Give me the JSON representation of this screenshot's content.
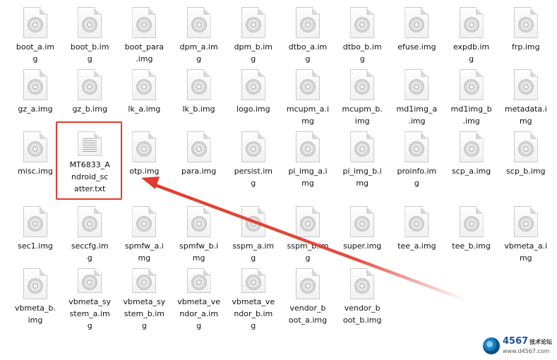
{
  "files": [
    {
      "name": "boot_a.img",
      "label_lines": [
        "boot_a.im",
        "g"
      ],
      "type": "img"
    },
    {
      "name": "boot_b.img",
      "label_lines": [
        "boot_b.im",
        "g"
      ],
      "type": "img"
    },
    {
      "name": "boot_para.img",
      "label_lines": [
        "boot_para",
        ".img"
      ],
      "type": "img"
    },
    {
      "name": "dpm_a.img",
      "label_lines": [
        "dpm_a.im",
        "g"
      ],
      "type": "img"
    },
    {
      "name": "dpm_b.img",
      "label_lines": [
        "dpm_b.im",
        "g"
      ],
      "type": "img"
    },
    {
      "name": "dtbo_a.img",
      "label_lines": [
        "dtbo_a.im",
        "g"
      ],
      "type": "img"
    },
    {
      "name": "dtbo_b.img",
      "label_lines": [
        "dtbo_b.im",
        "g"
      ],
      "type": "img"
    },
    {
      "name": "efuse.img",
      "label_lines": [
        "efuse.img"
      ],
      "type": "img"
    },
    {
      "name": "expdb.img",
      "label_lines": [
        "expdb.im",
        "g"
      ],
      "type": "img"
    },
    {
      "name": "frp.img",
      "label_lines": [
        "frp.img"
      ],
      "type": "img"
    },
    {
      "name": "gz_a.img",
      "label_lines": [
        "gz_a.img"
      ],
      "type": "img"
    },
    {
      "name": "gz_b.img",
      "label_lines": [
        "gz_b.img"
      ],
      "type": "img"
    },
    {
      "name": "lk_a.img",
      "label_lines": [
        "lk_a.img"
      ],
      "type": "img"
    },
    {
      "name": "lk_b.img",
      "label_lines": [
        "lk_b.img"
      ],
      "type": "img"
    },
    {
      "name": "logo.img",
      "label_lines": [
        "logo.img"
      ],
      "type": "img"
    },
    {
      "name": "mcupm_a.img",
      "label_lines": [
        "mcupm_a.i",
        "mg"
      ],
      "type": "img"
    },
    {
      "name": "mcupm_b.img",
      "label_lines": [
        "mcupm_b.",
        "img"
      ],
      "type": "img"
    },
    {
      "name": "md1img_a.img",
      "label_lines": [
        "md1img_a",
        ".img"
      ],
      "type": "img"
    },
    {
      "name": "md1img_b.img",
      "label_lines": [
        "md1img_b",
        ".img"
      ],
      "type": "img"
    },
    {
      "name": "metadata.img",
      "label_lines": [
        "metadata.i",
        "mg"
      ],
      "type": "img"
    },
    {
      "name": "misc.img",
      "label_lines": [
        "misc.img"
      ],
      "type": "img"
    },
    {
      "name": "MT6833_Android_scatter.txt",
      "label_lines": [
        "MT6833_A",
        "ndroid_sc",
        "atter.txt"
      ],
      "type": "txt"
    },
    {
      "name": "otp.img",
      "label_lines": [
        "otp.img"
      ],
      "type": "img"
    },
    {
      "name": "para.img",
      "label_lines": [
        "para.img"
      ],
      "type": "img"
    },
    {
      "name": "persist.img",
      "label_lines": [
        "persist.im",
        "g"
      ],
      "type": "img"
    },
    {
      "name": "pi_img_a.img",
      "label_lines": [
        "pi_img_a.i",
        "mg"
      ],
      "type": "img"
    },
    {
      "name": "pi_img_b.img",
      "label_lines": [
        "pi_img_b.i",
        "mg"
      ],
      "type": "img"
    },
    {
      "name": "proinfo.img",
      "label_lines": [
        "proinfo.im",
        "g"
      ],
      "type": "img"
    },
    {
      "name": "scp_a.img",
      "label_lines": [
        "scp_a.img"
      ],
      "type": "img"
    },
    {
      "name": "scp_b.img",
      "label_lines": [
        "scp_b.img"
      ],
      "type": "img"
    },
    {
      "name": "sec1.img",
      "label_lines": [
        "sec1.img"
      ],
      "type": "img"
    },
    {
      "name": "seccfg.img",
      "label_lines": [
        "seccfg.im",
        "g"
      ],
      "type": "img"
    },
    {
      "name": "spmfw_a.img",
      "label_lines": [
        "spmfw_a.i",
        "mg"
      ],
      "type": "img"
    },
    {
      "name": "spmfw_b.img",
      "label_lines": [
        "spmfw_b.i",
        "mg"
      ],
      "type": "img"
    },
    {
      "name": "sspm_a.img",
      "label_lines": [
        "sspm_a.im",
        "g"
      ],
      "type": "img"
    },
    {
      "name": "sspm_b.img",
      "label_lines": [
        "sspm_b.im",
        "g"
      ],
      "type": "img"
    },
    {
      "name": "super.img",
      "label_lines": [
        "super.img"
      ],
      "type": "img"
    },
    {
      "name": "tee_a.img",
      "label_lines": [
        "tee_a.img"
      ],
      "type": "img"
    },
    {
      "name": "tee_b.img",
      "label_lines": [
        "tee_b.img"
      ],
      "type": "img"
    },
    {
      "name": "vbmeta_a.img",
      "label_lines": [
        "vbmeta_a.i",
        "mg"
      ],
      "type": "img"
    },
    {
      "name": "vbmeta_b.img",
      "label_lines": [
        "vbmeta_b.",
        "img"
      ],
      "type": "img"
    },
    {
      "name": "vbmeta_system_a.img",
      "label_lines": [
        "vbmeta_sy",
        "stem_a.im",
        "g"
      ],
      "type": "img"
    },
    {
      "name": "vbmeta_system_b.img",
      "label_lines": [
        "vbmeta_sy",
        "stem_b.im",
        "g"
      ],
      "type": "img"
    },
    {
      "name": "vbmeta_vendor_a.img",
      "label_lines": [
        "vbmeta_ve",
        "ndor_a.im",
        "g"
      ],
      "type": "img"
    },
    {
      "name": "vbmeta_vendor_b.img",
      "label_lines": [
        "vbmeta_ve",
        "ndor_b.im",
        "g"
      ],
      "type": "img"
    },
    {
      "name": "vendor_boot_a.img",
      "label_lines": [
        "vendor_b",
        "oot_a.img"
      ],
      "type": "img"
    },
    {
      "name": "vendor_boot_b.img",
      "label_lines": [
        "vendor_b",
        "oot_b.img"
      ],
      "type": "img"
    }
  ],
  "highlight": {
    "target": "MT6833_Android_scatter.txt",
    "color": "#e03b2e"
  },
  "watermark": {
    "brand": "4567",
    "brand_suffix": "技术论坛",
    "url": "www.d4567.com"
  }
}
